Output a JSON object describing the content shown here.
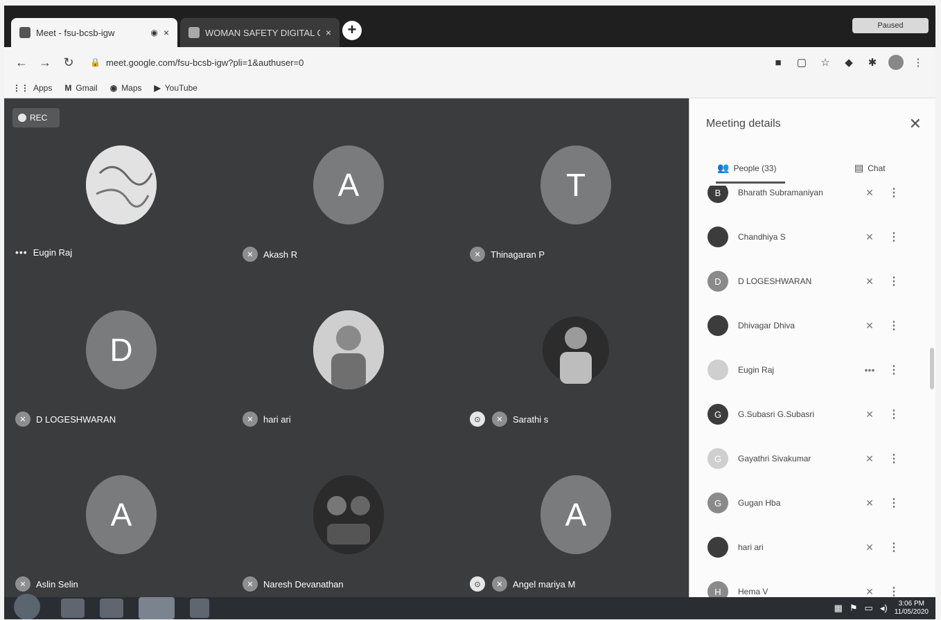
{
  "browser": {
    "tabs": [
      {
        "title": "Meet - fsu-bcsb-igw",
        "active": true
      },
      {
        "title": "WOMAN SAFETY DIGITAL CRO",
        "active": false
      }
    ],
    "new_tab_label": "+",
    "profile_label": "Paused",
    "url": "meet.google.com/fsu-bcsb-igw?pli=1&authuser=0",
    "bookmarks": [
      {
        "icon": "⋮⋮",
        "label": "Apps"
      },
      {
        "icon": "M",
        "label": "Gmail"
      },
      {
        "icon": "◉",
        "label": "Maps"
      },
      {
        "icon": "▶",
        "label": "YouTube"
      }
    ]
  },
  "meet": {
    "rec_label": "REC",
    "tiles": [
      {
        "name": "Eugin Raj",
        "initial": "",
        "photo": true,
        "pinned": false,
        "dots": true
      },
      {
        "name": "Akash R",
        "initial": "A",
        "photo": false,
        "pinned": false,
        "dots": false
      },
      {
        "name": "Thinagaran P",
        "initial": "T",
        "photo": false,
        "pinned": false,
        "dots": false
      },
      {
        "name": "D LOGESHWARAN",
        "initial": "D",
        "photo": false,
        "pinned": false,
        "dots": false
      },
      {
        "name": "hari ari",
        "initial": "",
        "photo": true,
        "pinned": false,
        "dots": false
      },
      {
        "name": "Sarathi s",
        "initial": "",
        "photo": true,
        "pinned": true,
        "dots": false
      },
      {
        "name": "Aslin Selin",
        "initial": "A",
        "photo": false,
        "pinned": false,
        "dots": false
      },
      {
        "name": "Naresh Devanathan",
        "initial": "",
        "photo": true,
        "pinned": false,
        "dots": false
      },
      {
        "name": "Angel mariya M",
        "initial": "A",
        "photo": false,
        "pinned": true,
        "dots": false
      }
    ]
  },
  "panel": {
    "title": "Meeting details",
    "people_tab": "People (33)",
    "chat_tab": "Chat",
    "people": [
      {
        "name": "Bharath Subramaniyan",
        "initial": "B",
        "tone": "dark",
        "mic": "✕"
      },
      {
        "name": "Chandhiya S",
        "initial": "",
        "tone": "dark",
        "mic": "✕"
      },
      {
        "name": "D LOGESHWARAN",
        "initial": "D",
        "tone": "",
        "mic": "✕"
      },
      {
        "name": "Dhivagar Dhiva",
        "initial": "",
        "tone": "dark",
        "mic": "✕"
      },
      {
        "name": "Eugin Raj",
        "initial": "",
        "tone": "light",
        "mic": "•••"
      },
      {
        "name": "G.Subasri G.Subasri",
        "initial": "G",
        "tone": "dark",
        "mic": "✕"
      },
      {
        "name": "Gayathri Sivakumar",
        "initial": "G",
        "tone": "light",
        "mic": "✕"
      },
      {
        "name": "Gugan Hba",
        "initial": "G",
        "tone": "",
        "mic": "✕"
      },
      {
        "name": "hari ari",
        "initial": "",
        "tone": "dark",
        "mic": "✕"
      },
      {
        "name": "Hema V",
        "initial": "H",
        "tone": "",
        "mic": "✕"
      }
    ]
  },
  "taskbar": {
    "time": "3:06 PM",
    "date": "11/05/2020"
  }
}
